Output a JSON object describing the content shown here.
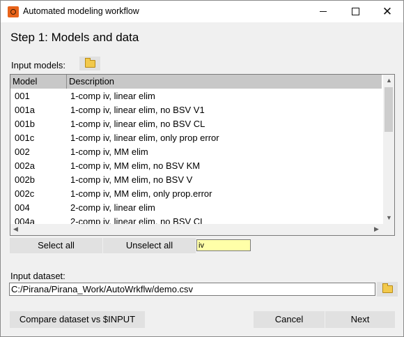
{
  "window": {
    "title": "Automated modeling workflow"
  },
  "step_title": "Step 1: Models and data",
  "input_models_label": "Input models:",
  "table": {
    "columns": [
      "Model",
      "Description"
    ],
    "rows": [
      {
        "model": "001",
        "description": "1-comp iv, linear elim"
      },
      {
        "model": "001a",
        "description": "1-comp iv, linear elim, no BSV V1"
      },
      {
        "model": "001b",
        "description": "1-comp iv, linear elim, no BSV CL"
      },
      {
        "model": "001c",
        "description": "1-comp iv, linear elim, only prop error"
      },
      {
        "model": "002",
        "description": "1-comp iv, MM elim"
      },
      {
        "model": "002a",
        "description": "1-comp iv, MM elim, no BSV KM"
      },
      {
        "model": "002b",
        "description": "1-comp iv, MM elim, no BSV V"
      },
      {
        "model": "002c",
        "description": "1-comp iv, MM elim, only prop.error"
      },
      {
        "model": "004",
        "description": "2-comp iv, linear elim"
      },
      {
        "model": "004a",
        "description": "2-comp iv, linear elim, no BSV CL"
      }
    ]
  },
  "select_all_label": "Select all",
  "unselect_all_label": "Unselect all",
  "filter_value": "iv",
  "input_dataset_label": "Input dataset:",
  "dataset_path": "C:/Pirana/Pirana_Work/AutoWrkflw/demo.csv",
  "compare_button_label": "Compare dataset vs $INPUT",
  "cancel_button_label": "Cancel",
  "next_button_label": "Next",
  "colors": {
    "header": "#c8c8c8",
    "filter_bg": "#ffffa8",
    "button": "#e1e1e1",
    "app_icon": "#e8631a"
  }
}
